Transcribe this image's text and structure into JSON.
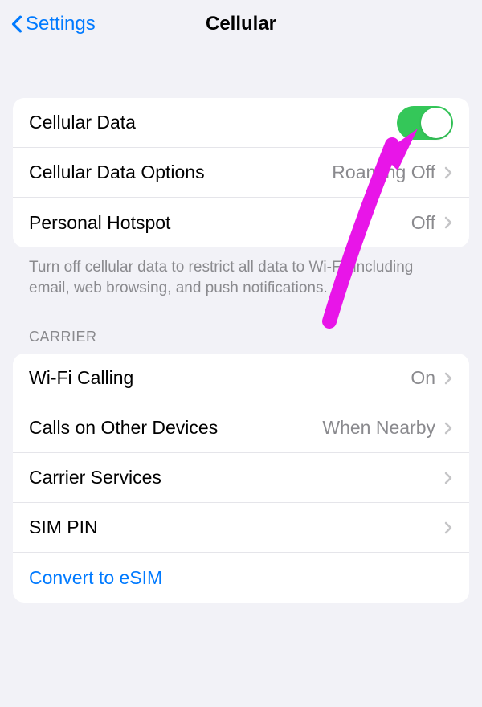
{
  "nav": {
    "back_label": "Settings",
    "title": "Cellular"
  },
  "group1": {
    "cellular_data": {
      "label": "Cellular Data",
      "on": true
    },
    "cellular_data_options": {
      "label": "Cellular Data Options",
      "value": "Roaming Off"
    },
    "personal_hotspot": {
      "label": "Personal Hotspot",
      "value": "Off"
    },
    "footer": "Turn off cellular data to restrict all data to Wi-Fi, including email, web browsing, and push notifications."
  },
  "carrier": {
    "header": "CARRIER",
    "wifi_calling": {
      "label": "Wi-Fi Calling",
      "value": "On"
    },
    "calls_other": {
      "label": "Calls on Other Devices",
      "value": "When Nearby"
    },
    "carrier_services": {
      "label": "Carrier Services"
    },
    "sim_pin": {
      "label": "SIM PIN"
    },
    "convert_esim": {
      "label": "Convert to eSIM"
    }
  },
  "colors": {
    "accent": "#007aff",
    "toggle_on": "#34c759",
    "annotation": "#e815e8"
  }
}
